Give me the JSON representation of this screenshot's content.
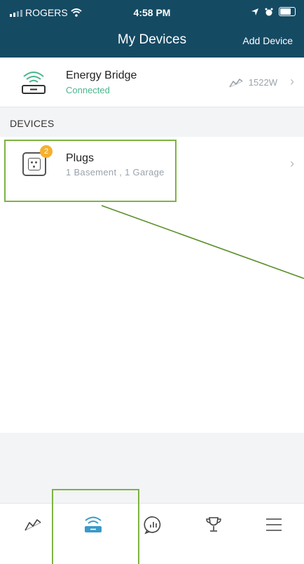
{
  "status_bar": {
    "carrier": "ROGERS",
    "time": "4:58 PM"
  },
  "header": {
    "title": "My Devices",
    "add_button": "Add Device"
  },
  "energy_bridge": {
    "name": "Energy Bridge",
    "status": "Connected",
    "power": "1522W"
  },
  "devices_section": {
    "label": "DEVICES"
  },
  "devices": [
    {
      "name": "Plugs",
      "badge": "2",
      "subtitle": "1 Basement , 1 Garage"
    }
  ],
  "tabbar": {
    "tabs": [
      {
        "icon": "graph-icon",
        "active": false
      },
      {
        "icon": "bridge-icon",
        "active": true
      },
      {
        "icon": "insights-icon",
        "active": false
      },
      {
        "icon": "trophy-icon",
        "active": false
      },
      {
        "icon": "menu-icon",
        "active": false
      }
    ]
  },
  "colors": {
    "header_bg": "#154a63",
    "connected": "#4ab58c",
    "active_tab": "#3a9ac9",
    "badge": "#f5b02e",
    "highlight": "#7cb342"
  }
}
